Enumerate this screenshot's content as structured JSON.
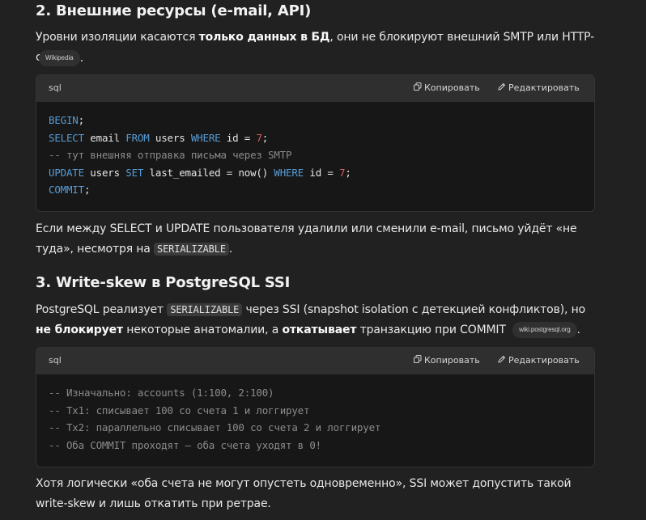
{
  "section2": {
    "heading": "2. Внешние ресурсы (e-mail, API)",
    "p1": {
      "before": "Уровни изоляции касаются ",
      "bold": "только данных в БД",
      "after": ", они не блокируют внешний SMTP или HTTP-сервис",
      "source": "Wikipedia",
      "end": "."
    },
    "code": {
      "lang": "sql",
      "copy_label": "Копировать",
      "edit_label": "Редактировать",
      "lines": [
        [
          {
            "t": "BEGIN",
            "c": "kw"
          },
          {
            "t": ";"
          }
        ],
        [
          {
            "t": "SELECT",
            "c": "kw"
          },
          {
            "t": " email "
          },
          {
            "t": "FROM",
            "c": "kw"
          },
          {
            "t": " users "
          },
          {
            "t": "WHERE",
            "c": "kw"
          },
          {
            "t": " id = "
          },
          {
            "t": "7",
            "c": "num"
          },
          {
            "t": ";"
          }
        ],
        [
          {
            "t": "-- тут внешняя отправка письма через SMTP",
            "c": "cm"
          }
        ],
        [
          {
            "t": "UPDATE",
            "c": "kw"
          },
          {
            "t": " users "
          },
          {
            "t": "SET",
            "c": "kw"
          },
          {
            "t": " last_emailed = now() "
          },
          {
            "t": "WHERE",
            "c": "kw"
          },
          {
            "t": " id = "
          },
          {
            "t": "7",
            "c": "num"
          },
          {
            "t": ";"
          }
        ],
        [
          {
            "t": "COMMIT",
            "c": "kw"
          },
          {
            "t": ";"
          }
        ]
      ]
    },
    "p2": {
      "before": "Если между SELECT и UPDATE пользователя удалили или сменили e-mail, письмо уйдёт «не туда», несмотря на ",
      "code": "SERIALIZABLE",
      "after": "."
    }
  },
  "section3": {
    "heading": "3. Write-skew в PostgreSQL SSI",
    "p1": {
      "t1": "PostgreSQL реализует ",
      "code": "SERIALIZABLE",
      "t2": " через SSI (snapshot isolation с детекцией конфликтов), но ",
      "b1": "не блокирует",
      "t3": " некоторые анатомалии, а ",
      "b2": "откатывает",
      "t4": " транзакцию при COMMIT",
      "source": "wiki.postgresql.org",
      "end": "."
    },
    "code": {
      "lang": "sql",
      "copy_label": "Копировать",
      "edit_label": "Редактировать",
      "lines": [
        [
          {
            "t": "-- Изначально: accounts (1:100, 2:100)",
            "c": "cm"
          }
        ],
        [
          {
            "t": "-- Tx1: списывает 100 со счета 1 и логгирует",
            "c": "cm"
          }
        ],
        [
          {
            "t": "-- Tx2: параллельно списывает 100 со счета 2 и логгирует",
            "c": "cm"
          }
        ],
        [
          {
            "t": "-- Оба COMMIT проходят — оба счета уходят в 0!",
            "c": "cm"
          }
        ]
      ]
    },
    "p2": {
      "text": "Хотя логически «оба счета не могут опустеть одновременно», SSI может допустить такой write-skew и лишь откатить при ретрае."
    }
  },
  "icons": {
    "copy": "copy-icon",
    "edit": "edit-pencil-icon"
  }
}
